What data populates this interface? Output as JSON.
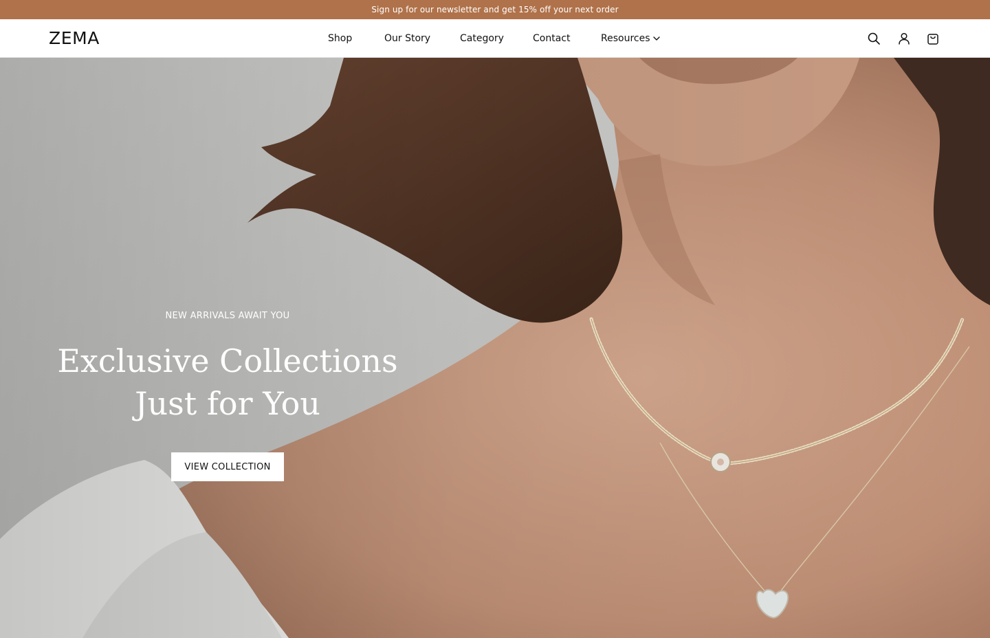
{
  "colors": {
    "announcement_bg": "#B0724A",
    "header_bg": "#FFFFFF",
    "text_dark": "#111111",
    "hero_wall": "#C9C9C7",
    "skin": "#C79A80",
    "hair": "#5A3A28",
    "shirt": "#F2F2F0"
  },
  "announcement": {
    "text": "Sign up for our newsletter and get 15% off your next order"
  },
  "header": {
    "logo": "ZEMA",
    "nav": [
      {
        "label": "Shop"
      },
      {
        "label": "Our Story"
      },
      {
        "label": "Category"
      },
      {
        "label": "Contact"
      },
      {
        "label": "Resources",
        "icon": "chevron-down-icon"
      }
    ],
    "icons": [
      "search-icon",
      "account-icon",
      "cart-icon"
    ]
  },
  "hero": {
    "eyebrow": "NEW ARRIVALS AWAIT YOU",
    "headline_line1": "Exclusive Collections",
    "headline_line2": "Just for You",
    "cta_label": "VIEW COLLECTION",
    "image": "woman wearing gold beaded choker and heart pendant necklace"
  }
}
